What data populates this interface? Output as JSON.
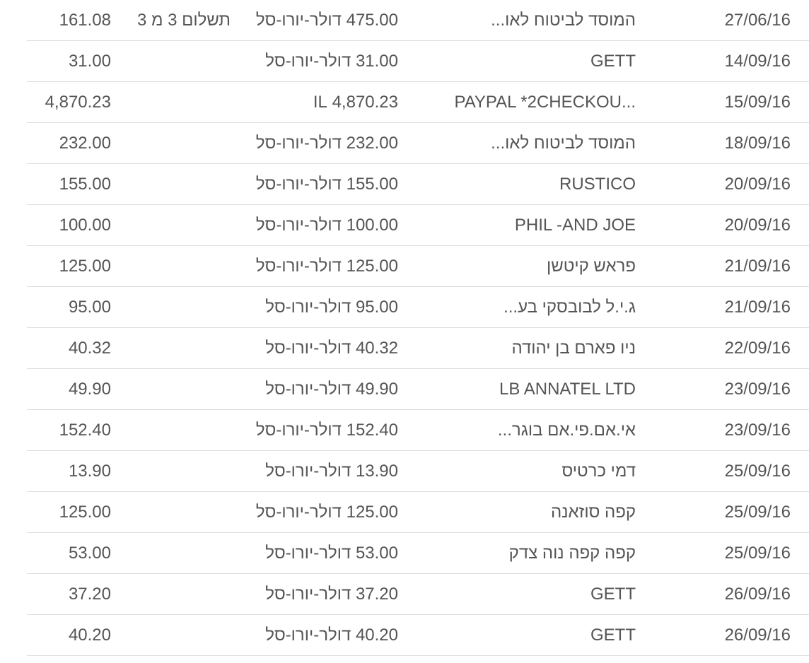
{
  "transactions": [
    {
      "date": "27/06/16",
      "merchant": "המוסד לביטוח לאו...",
      "orig_amount": "475.00",
      "currency": "דולר-יורו-סל",
      "note": "תשלום 3 מ 3",
      "charged": "161.08"
    },
    {
      "date": "14/09/16",
      "merchant": "GETT",
      "orig_amount": "31.00",
      "currency": "דולר-יורו-סל",
      "note": "",
      "charged": "31.00"
    },
    {
      "date": "15/09/16",
      "merchant": "PAYPAL *2CHECKOU...",
      "orig_amount": "4,870.23",
      "currency": "IL",
      "note": "",
      "charged": "4,870.23"
    },
    {
      "date": "18/09/16",
      "merchant": "המוסד לביטוח לאו...",
      "orig_amount": "232.00",
      "currency": "דולר-יורו-סל",
      "note": "",
      "charged": "232.00"
    },
    {
      "date": "20/09/16",
      "merchant": "RUSTICO",
      "orig_amount": "155.00",
      "currency": "דולר-יורו-סל",
      "note": "",
      "charged": "155.00"
    },
    {
      "date": "20/09/16",
      "merchant": "PHIL -AND JOE",
      "orig_amount": "100.00",
      "currency": "דולר-יורו-סל",
      "note": "",
      "charged": "100.00"
    },
    {
      "date": "21/09/16",
      "merchant": "פראש קיטשן",
      "orig_amount": "125.00",
      "currency": "דולר-יורו-סל",
      "note": "",
      "charged": "125.00"
    },
    {
      "date": "21/09/16",
      "merchant": "ג.י.ל לבובסקי בע...",
      "orig_amount": "95.00",
      "currency": "דולר-יורו-סל",
      "note": "",
      "charged": "95.00"
    },
    {
      "date": "22/09/16",
      "merchant": "ניו פארם בן יהודה",
      "orig_amount": "40.32",
      "currency": "דולר-יורו-סל",
      "note": "",
      "charged": "40.32"
    },
    {
      "date": "23/09/16",
      "merchant": "LB ANNATEL LTD",
      "orig_amount": "49.90",
      "currency": "דולר-יורו-סל",
      "note": "",
      "charged": "49.90"
    },
    {
      "date": "23/09/16",
      "merchant": "אי.אם.פי.אם בוגר...",
      "orig_amount": "152.40",
      "currency": "דולר-יורו-סל",
      "note": "",
      "charged": "152.40"
    },
    {
      "date": "25/09/16",
      "merchant": "דמי כרטיס",
      "orig_amount": "13.90",
      "currency": "דולר-יורו-סל",
      "note": "",
      "charged": "13.90"
    },
    {
      "date": "25/09/16",
      "merchant": "קפה סוזאנה",
      "orig_amount": "125.00",
      "currency": "דולר-יורו-סל",
      "note": "",
      "charged": "125.00"
    },
    {
      "date": "25/09/16",
      "merchant": "קפה קפה נוה צדק",
      "orig_amount": "53.00",
      "currency": "דולר-יורו-סל",
      "note": "",
      "charged": "53.00"
    },
    {
      "date": "26/09/16",
      "merchant": "GETT",
      "orig_amount": "37.20",
      "currency": "דולר-יורו-סל",
      "note": "",
      "charged": "37.20"
    },
    {
      "date": "26/09/16",
      "merchant": "GETT",
      "orig_amount": "40.20",
      "currency": "דולר-יורו-סל",
      "note": "",
      "charged": "40.20"
    }
  ]
}
